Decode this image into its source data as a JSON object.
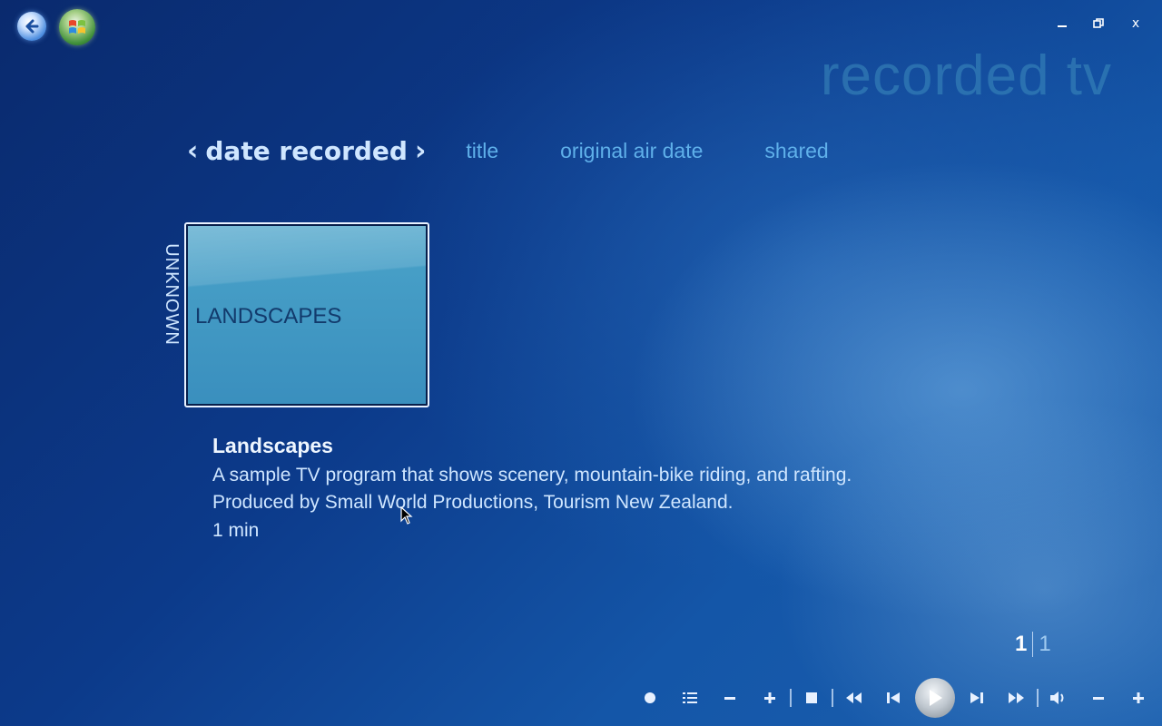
{
  "window": {
    "controls": {
      "minimize_icon": "minimize-icon",
      "restore_icon": "restore-icon",
      "close_label": "x"
    }
  },
  "header": {
    "page_title": "recorded tv"
  },
  "sort_tabs": {
    "active": {
      "label": "date recorded",
      "prev_chevron": "‹",
      "next_chevron": "›"
    },
    "items": [
      {
        "label": "title"
      },
      {
        "label": "original air date"
      },
      {
        "label": "shared"
      }
    ]
  },
  "gallery": {
    "group_label": "UNKNOWN",
    "items": [
      {
        "thumbnail_text": "LANDSCAPES"
      }
    ]
  },
  "details": {
    "title": "Landscapes",
    "description_line1": "A sample TV program that shows scenery, mountain-bike riding, and rafting.",
    "description_line2": "Produced by Small World Productions, Tourism New Zealand.",
    "duration": "1 min"
  },
  "pager": {
    "current": "1",
    "total": "1"
  },
  "transport": {
    "buttons": [
      "record-icon",
      "guide-list-icon",
      "channel-minus-icon",
      "channel-plus-icon",
      "stop-icon",
      "rewind-icon",
      "previous-icon",
      "play-icon",
      "next-icon",
      "fast-forward-icon",
      "volume-icon",
      "volume-minus-icon",
      "volume-plus-icon"
    ]
  },
  "colors": {
    "accent_tab": "#5fb0ea",
    "active_tab": "#cfe6ff",
    "title_faded": "#3c8cbe"
  }
}
